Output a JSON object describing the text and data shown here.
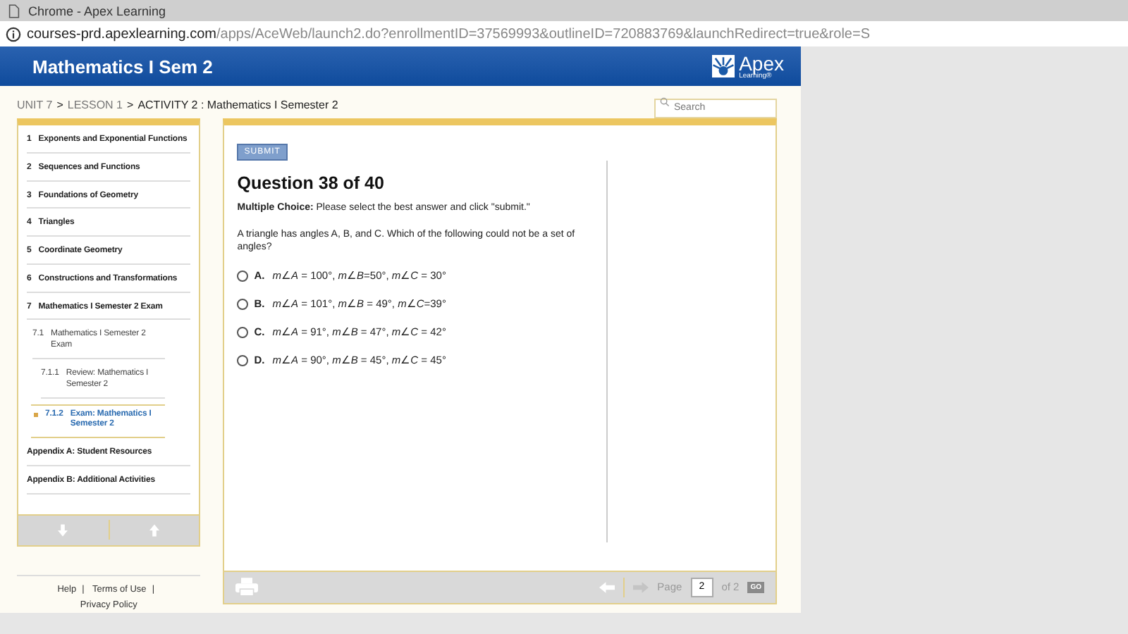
{
  "window": {
    "title": "Chrome - Apex Learning"
  },
  "address_bar": {
    "domain": "courses-prd.apexlearning.com",
    "path": "/apps/AceWeb/launch2.do?enrollmentID=37569993&outlineID=720883769&launchRedirect=true&role=S"
  },
  "header": {
    "course_title": "Mathematics I Sem 2",
    "logo_name": "Apex",
    "logo_sub": "Learning®"
  },
  "breadcrumb": [
    {
      "label": "UNIT 7",
      "link": true
    },
    {
      "label": "LESSON 1",
      "link": true
    },
    {
      "label": "ACTIVITY 2 : Mathematics I Semester 2",
      "link": false
    }
  ],
  "breadcrumb_separator": ">",
  "search": {
    "placeholder": "Search"
  },
  "sidebar": {
    "items": [
      {
        "number": "1",
        "label": "Exponents and Exponential Functions",
        "selected": false
      },
      {
        "number": "2",
        "label": "Sequences and Functions",
        "selected": false
      },
      {
        "number": "3",
        "label": "Foundations of Geometry",
        "selected": false
      },
      {
        "number": "4",
        "label": "Triangles",
        "selected": false
      },
      {
        "number": "5",
        "label": "Coordinate Geometry",
        "selected": false
      },
      {
        "number": "6",
        "label": "Constructions and Transformations",
        "selected": false
      },
      {
        "number": "7",
        "label": "Mathematics I Semester 2 Exam",
        "selected": false,
        "children": [
          {
            "number": "7.1",
            "label": "Mathematics I Semester 2 Exam",
            "selected": false,
            "children": [
              {
                "number": "7.1.1",
                "label": "Review: Mathematics I Semester 2",
                "selected": false
              },
              {
                "number": "7.1.2",
                "label": "Exam: Mathematics I Semester 2",
                "selected": true
              }
            ]
          }
        ]
      },
      {
        "label": "Appendix A: Student Resources",
        "selected": false
      },
      {
        "label": "Appendix B: Additional Activities",
        "selected": false
      }
    ]
  },
  "footer_links": [
    "Help",
    "Terms of Use",
    "Privacy Policy"
  ],
  "footer_separator": "|",
  "question": {
    "submit": "SUBMIT",
    "title": "Question 38 of 40",
    "instruction": "**Multiple Choice:** Please select the best answer and click \"submit.\"",
    "prompt": "A triangle has angles A, B, and C. Which of the following could not be a set of angles?",
    "options": [
      {
        "letter": "A.",
        "text": "*m*∠*A* = 100°, *m*∠*B*=50°, *m*∠*C* = 30°",
        "selected": false
      },
      {
        "letter": "B.",
        "text": "*m*∠*A* = 101°, *m*∠*B* = 49°, *m*∠*C*=39°",
        "selected": false
      },
      {
        "letter": "C.",
        "text": "*m*∠*A* = 91°, *m*∠*B* = 47°, *m*∠*C* = 42°",
        "selected": false
      },
      {
        "letter": "D.",
        "text": "*m*∠*A* = 90°, *m*∠*B* = 45°, *m*∠*C* = 45°",
        "selected": false
      }
    ]
  },
  "pager": {
    "label": "Page",
    "value": "2",
    "of": "of 2",
    "go": "GO"
  }
}
